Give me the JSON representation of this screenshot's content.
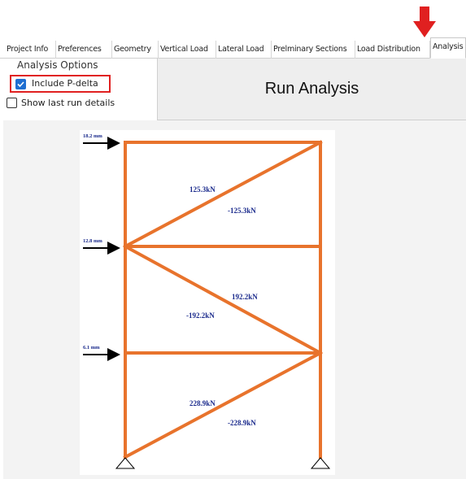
{
  "tabs": [
    {
      "label": "Project Info"
    },
    {
      "label": "Preferences"
    },
    {
      "label": "Geometry"
    },
    {
      "label": "Vertical Load"
    },
    {
      "label": "Lateral Load"
    },
    {
      "label": "Prelminary Sections"
    },
    {
      "label": "Load Distribution"
    },
    {
      "label": "Analysis",
      "active": true
    }
  ],
  "options": {
    "title": "Analysis Options",
    "include_pdelta": {
      "label": "Include P-delta",
      "checked": true
    },
    "show_last_run": {
      "label": "Show last run details",
      "checked": false
    }
  },
  "run_button": {
    "label": "Run Analysis"
  },
  "frame": {
    "displacements": [
      {
        "label": "18.2 mm",
        "story": "top"
      },
      {
        "label": "12.8 mm",
        "story": "middle"
      },
      {
        "label": "6.1 mm",
        "story": "bottom"
      }
    ],
    "forces": {
      "story3_pos": "125.3kN",
      "story3_neg": "-125.3kN",
      "story2_pos": "192.2kN",
      "story2_neg": "-192.2kN",
      "story1_pos": "228.9kN",
      "story1_neg": "-228.9kN"
    }
  },
  "colors": {
    "member": "#e8732c",
    "force_text": "#1a2a8c",
    "pointer": "#e02020",
    "checkbox_checked": "#1f6fd1"
  }
}
